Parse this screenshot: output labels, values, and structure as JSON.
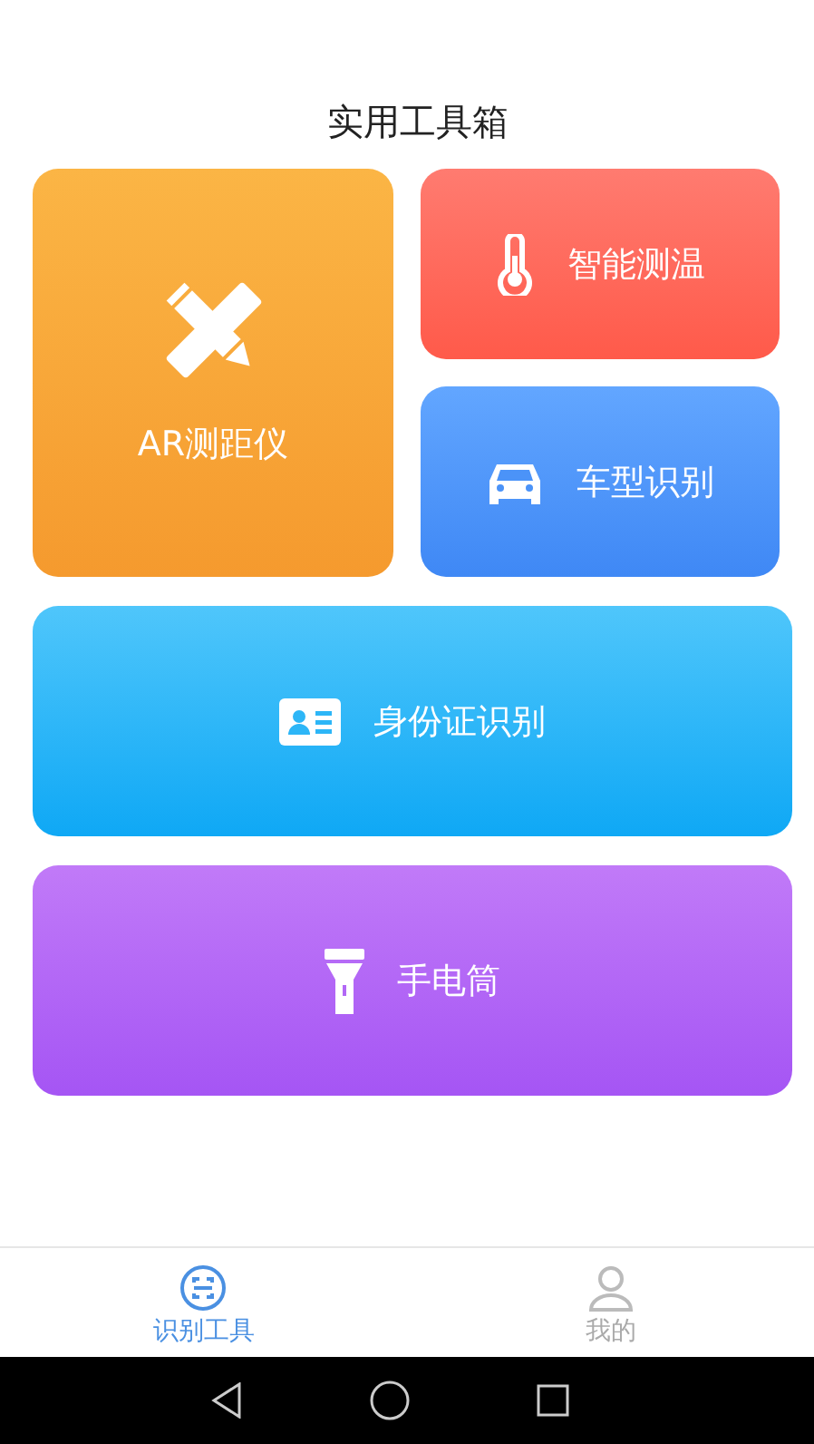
{
  "title": "实用工具箱",
  "tools": [
    {
      "kind": "ruler",
      "label": "AR测距仪"
    },
    {
      "kind": "thermometer",
      "label": "智能测温"
    },
    {
      "kind": "car",
      "label": "车型识别"
    },
    {
      "kind": "id-card",
      "label": "身份证识别"
    },
    {
      "kind": "flashlight",
      "label": "手电筒"
    }
  ],
  "tabs": [
    {
      "kind": "scan",
      "label": "识别工具",
      "selected": true
    },
    {
      "kind": "person",
      "label": "我的",
      "selected": false
    }
  ]
}
